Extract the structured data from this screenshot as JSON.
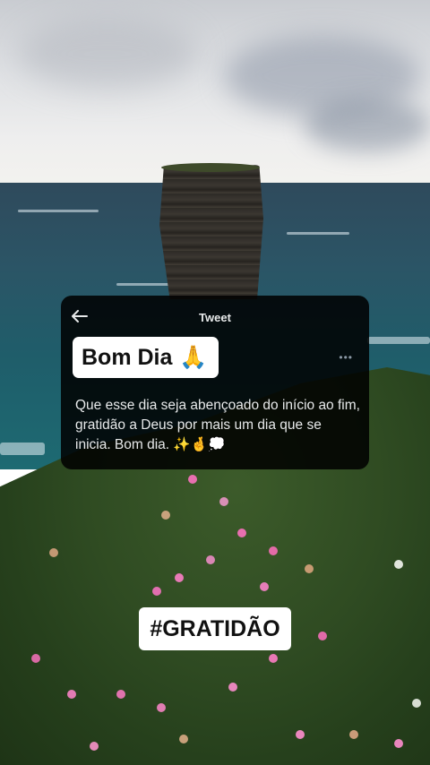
{
  "tweet": {
    "header_title": "Tweet",
    "greeting": "Bom Dia",
    "greeting_emoji": "🙏",
    "body": "Que esse dia seja abençoado do início ao fim, gratidão a Deus por mais um dia que se inicia. Bom dia. ✨🤞💭",
    "icons": {
      "back": "back-arrow-icon",
      "more": "more-options-icon"
    }
  },
  "hashtag": "#GRATIDÃO",
  "colors": {
    "card_bg": "#000000",
    "pill_bg": "#ffffff",
    "text_dark": "#111111",
    "text_light": "#e7e9ea"
  }
}
